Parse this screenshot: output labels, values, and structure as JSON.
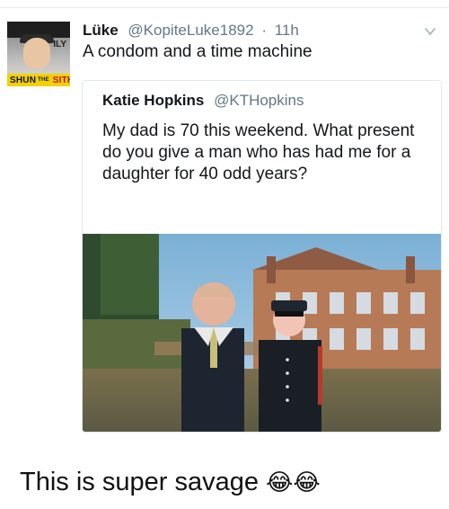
{
  "tweet": {
    "author_name": "Lüke",
    "author_handle": "@KopiteLuke1892",
    "separator": "·",
    "time": "11h",
    "text": "A condom and a time machine",
    "avatar_badge": "SHUN",
    "avatar_badge_small": "THE",
    "avatar_badge_end": "SITH",
    "avatar_mark": "ILY"
  },
  "quoted_tweet": {
    "author_name": "Katie Hopkins",
    "author_handle": "@KTHopkins",
    "text": "My dad is 70 this weekend. What present do you give a man who has had me for a daughter for 40 odd years?"
  },
  "caption": {
    "text": "This is super savage",
    "emoji": "😂😂"
  },
  "icons": {
    "menu": "chevron-down-icon"
  }
}
